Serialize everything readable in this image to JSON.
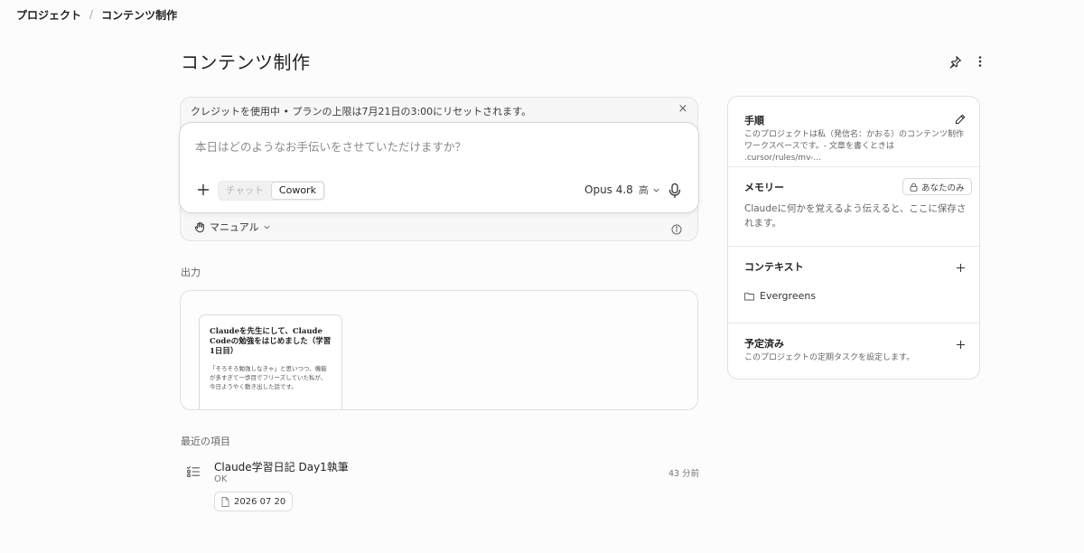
{
  "breadcrumb": {
    "root": "プロジェクト",
    "separator": "/",
    "current": "コンテンツ制作"
  },
  "page": {
    "title": "コンテンツ制作"
  },
  "notice": {
    "text": "クレジットを使用中 • プランの上限は7月21日の3:00にリセットされます。",
    "close": "×"
  },
  "composer": {
    "placeholder": "本日はどのようなお手伝いをさせていただけますか？",
    "modes": [
      "チャット",
      "Cowork"
    ],
    "active_mode": "Cowork",
    "model": "Opus 4.8",
    "effort": "高"
  },
  "permission": {
    "label": "マニュアル"
  },
  "output": {
    "label": "出力",
    "doc_title": "Claudeを先生にして、Claude Codeの勉強をはじめました（学習1日目）",
    "doc_body": "「そろそろ勉強しなきゃ」と思いつつ、機能が多すぎて一歩目でフリーズしていた私が、今日ようやく動き出した話です。"
  },
  "recent": {
    "label": "最近の項目",
    "items": [
      {
        "title": "Claude学習日記 Day1執筆",
        "status": "OK",
        "time": "43 分前",
        "file": "2026 07 20"
      }
    ]
  },
  "sidebar": {
    "instructions": {
      "title": "手順",
      "text": "このプロジェクトは私（発信名：かおる）のコンテンツ制作ワークスペースです。- 文章を書くときは .cursor/rules/mv-..."
    },
    "memory": {
      "title": "メモリー",
      "badge": "あなたのみ",
      "text": "Claudeに何かを覚えるよう伝えると、ここに保存されます。"
    },
    "context": {
      "title": "コンテキスト",
      "items": [
        "Evergreens"
      ]
    },
    "scheduled": {
      "title": "予定済み",
      "text": "このプロジェクトの定期タスクを設定します。"
    }
  },
  "colors": {
    "background": "#fcfcfc",
    "card_border": "#e0e0e0",
    "text": "#2b2b2b",
    "muted": "#666666"
  }
}
